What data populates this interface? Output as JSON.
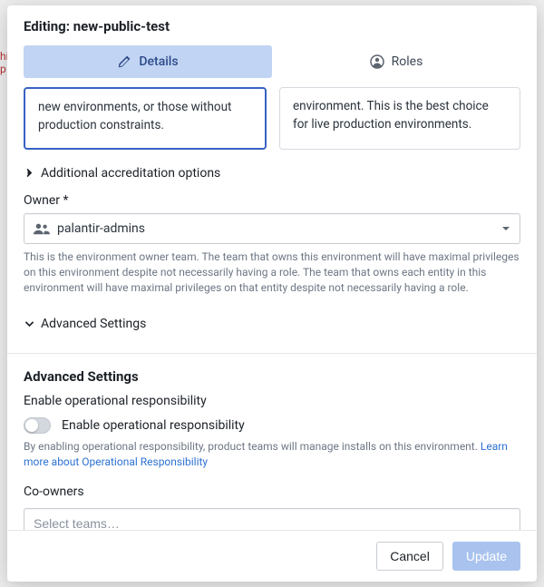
{
  "header": {
    "title": "Editing: new-public-test"
  },
  "tabs": {
    "details": "Details",
    "roles": "Roles"
  },
  "cards": {
    "left": "new environments, or those without production constraints.",
    "right": "environment. This is the best choice for live production environments."
  },
  "accreditation": {
    "label": "Additional accreditation options"
  },
  "owner": {
    "label": "Owner *",
    "value": "palantir-admins",
    "help": "This is the environment owner team. The team that owns this environment will have maximal privileges on this environment despite not necessarily having a role. The team that owns each entity in this environment will have maximal privileges on that entity despite not necessarily having a role."
  },
  "advancedToggle": {
    "label": "Advanced Settings"
  },
  "advanced": {
    "header": "Advanced Settings",
    "opResp": {
      "label": "Enable operational responsibility",
      "toggleLabel": "Enable operational responsibility",
      "help": "By enabling operational responsibility, product teams will manage installs on this environment. ",
      "link": "Learn more about Operational Responsibility"
    },
    "coowners": {
      "label": "Co-owners",
      "placeholder": "Select teams…"
    }
  },
  "footer": {
    "cancel": "Cancel",
    "update": "Update"
  }
}
